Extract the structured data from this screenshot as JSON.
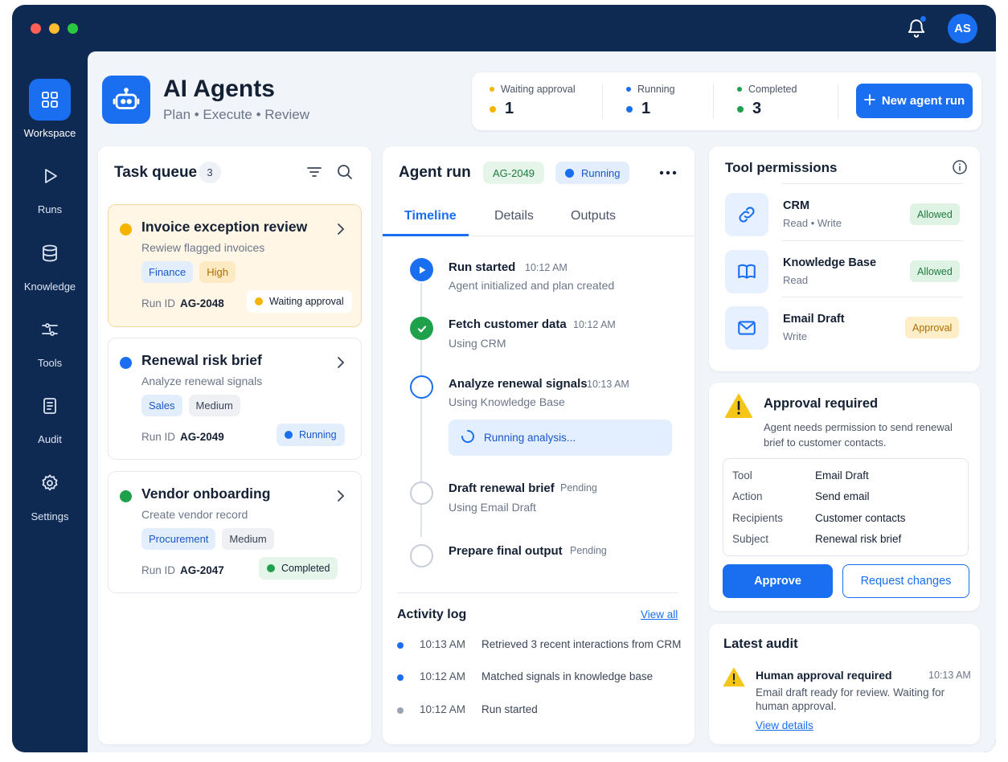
{
  "colors": {
    "window_bg": "#0f2a52",
    "accent": "#1a6ff0",
    "waiting": "#f5b400",
    "running": "#1a6ff0",
    "completed": "#1fa04b",
    "pending": "#9aa3b2"
  },
  "user": {
    "initials": "AS"
  },
  "nav": [
    {
      "label": "Workspace",
      "icon": "grid-icon",
      "active": true
    },
    {
      "label": "Runs",
      "icon": "play-icon",
      "active": false
    },
    {
      "label": "Knowledge",
      "icon": "database-icon",
      "active": false
    },
    {
      "label": "Tools",
      "icon": "tools-icon",
      "active": false
    },
    {
      "label": "Audit",
      "icon": "document-icon",
      "active": false
    },
    {
      "label": "Settings",
      "icon": "gear-icon",
      "active": false
    }
  ],
  "header": {
    "title": "AI Agents",
    "subtitle": "Plan • Execute • Review",
    "icon": "robot-icon"
  },
  "stats": [
    {
      "label": "Waiting approval",
      "value": "1",
      "color": "#f5b400"
    },
    {
      "label": "Running",
      "value": "1",
      "color": "#1a6ff0"
    },
    {
      "label": "Completed",
      "value": "3",
      "color": "#1fa04b"
    }
  ],
  "new_run_label": "New agent run",
  "task_queue": {
    "title": "Task queue",
    "count": "3",
    "run_id_label": "Run ID",
    "tasks": [
      {
        "title": "Invoice exception review",
        "desc": "Rewiew flagged invoices",
        "tags": [
          "Finance",
          "High"
        ],
        "run_id": "AG-2048",
        "status": "Waiting approval"
      },
      {
        "title": "Renewal risk brief",
        "desc": "Analyze renewal signals",
        "tags": [
          "Sales",
          "Medium"
        ],
        "run_id": "AG-2049",
        "status": "Running"
      },
      {
        "title": "Vendor onboarding",
        "desc": "Create vendor record",
        "tags": [
          "Procurement",
          "Medium"
        ],
        "run_id": "AG-2047",
        "status": "Completed"
      }
    ]
  },
  "agent_run": {
    "title": "Agent run",
    "run_id": "AG-2049",
    "status": "Running",
    "tabs": [
      "Timeline",
      "Details",
      "Outputs"
    ],
    "active_tab": "Timeline",
    "timeline": [
      {
        "title": "Run started",
        "time": "10:12 AM",
        "sub": "Agent initialized and plan created",
        "state": "started"
      },
      {
        "title": "Fetch customer data",
        "time": "10:12 AM",
        "sub": "Using CRM",
        "state": "done"
      },
      {
        "title": "Analyze renewal signals",
        "time": "10:13 AM",
        "sub": "Using Knowledge Base",
        "state": "active"
      },
      {
        "title": "Draft renewal brief",
        "time": "Pending",
        "sub": "Using Email Draft",
        "state": "pending"
      },
      {
        "title": "Prepare final output",
        "time": "Pending",
        "sub": "",
        "state": "pending"
      }
    ],
    "running_text": "Running analysis...",
    "activity_log": {
      "title": "Activity log",
      "view_all": "View all",
      "entries": [
        {
          "time": "10:13 AM",
          "message": "Retrieved 3 recent interactions from CRM",
          "color": "#1a6ff0"
        },
        {
          "time": "10:12 AM",
          "message": "Matched signals in knowledge base",
          "color": "#1a6ff0"
        },
        {
          "time": "10:12 AM",
          "message": "Run started",
          "color": "#9aa3b2"
        }
      ]
    }
  },
  "tool_permissions": {
    "title": "Tool permissions",
    "items": [
      {
        "name": "CRM",
        "scope": "Read • Write",
        "status": "Allowed",
        "icon": "link-icon"
      },
      {
        "name": "Knowledge Base",
        "scope": "Read",
        "status": "Allowed",
        "icon": "book-icon"
      },
      {
        "name": "Email Draft",
        "scope": "Write",
        "status": "Approval",
        "icon": "mail-icon"
      }
    ]
  },
  "approval": {
    "title": "Approval required",
    "desc": "Agent needs permission to send renewal brief to customer contacts.",
    "fields": [
      {
        "key": "Tool",
        "value": "Email Draft"
      },
      {
        "key": "Action",
        "value": "Send email"
      },
      {
        "key": "Recipients",
        "value": "Customer contacts"
      },
      {
        "key": "Subject",
        "value": "Renewal risk brief"
      }
    ],
    "approve_label": "Approve",
    "request_label": "Request changes"
  },
  "latest_audit": {
    "title": "Latest audit",
    "item_title": "Human approval required",
    "time": "10:13 AM",
    "desc": "Email draft ready for review. Waiting for human approval.",
    "link": "View details"
  }
}
